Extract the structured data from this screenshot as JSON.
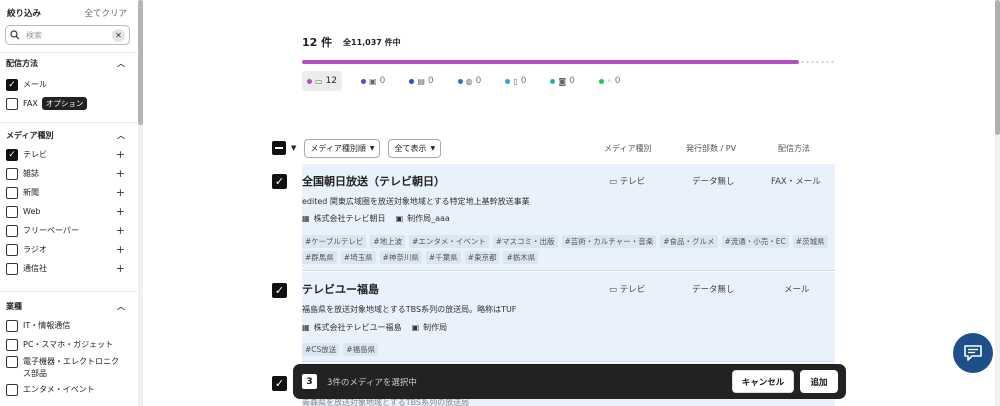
{
  "sidebar": {
    "title": "絞り込み",
    "clear_all": "全てクリア",
    "search_placeholder": "検索",
    "sections": [
      {
        "title": "配信方法",
        "options": [
          {
            "label": "メール",
            "checked": true
          },
          {
            "label": "FAX",
            "checked": false,
            "badge": "オプション"
          }
        ]
      },
      {
        "title": "メディア種別",
        "options": [
          {
            "label": "テレビ",
            "checked": true
          },
          {
            "label": "雑誌",
            "checked": false
          },
          {
            "label": "新聞",
            "checked": false
          },
          {
            "label": "Web",
            "checked": false
          },
          {
            "label": "フリーペーパー",
            "checked": false
          },
          {
            "label": "ラジオ",
            "checked": false
          },
          {
            "label": "通信社",
            "checked": false
          }
        ]
      },
      {
        "title": "業種",
        "options": [
          {
            "label": "IT・情報通信",
            "checked": false
          },
          {
            "label": "PC・スマホ・ガジェット",
            "checked": false
          },
          {
            "label": "電子機器・エレクトロニクス部品",
            "checked": false
          },
          {
            "label": "エンタメ・イベント",
            "checked": false
          }
        ]
      }
    ]
  },
  "results": {
    "count": "12 件",
    "total": "全11,037 件中",
    "progress_ratio": 0.93,
    "media_types": [
      {
        "icon": "tv-icon",
        "glyph": "▭",
        "count": "12",
        "color": "#b14fc5",
        "selected": true
      },
      {
        "icon": "magazine-icon",
        "glyph": "▣",
        "count": "0",
        "color": "#6a3fc9",
        "selected": false
      },
      {
        "icon": "newspaper-icon",
        "glyph": "▤",
        "count": "0",
        "color": "#1f4fd1",
        "selected": false
      },
      {
        "icon": "web-icon",
        "glyph": "◍",
        "count": "0",
        "color": "#2b6fe0",
        "selected": false
      },
      {
        "icon": "freepaper-icon",
        "glyph": "▯",
        "count": "0",
        "color": "#2aa0e6",
        "selected": false
      },
      {
        "icon": "radio-icon",
        "glyph": "◙",
        "count": "0",
        "color": "#1fb5a3",
        "selected": false
      },
      {
        "icon": "news-agency-icon",
        "glyph": "◦",
        "count": "0",
        "color": "#22c35a",
        "selected": false
      }
    ]
  },
  "toolbar": {
    "sort_label": "メディア種別順",
    "display_label": "全て表示",
    "col_media": "メディア種別",
    "col_dept": "発行部数 / PV",
    "col_delivery": "配信方法"
  },
  "rows": [
    {
      "name": "全国朝日放送（テレビ朝日）",
      "media": "テレビ",
      "dept": "データ無し",
      "delivery": "FAX・メール",
      "desc": "edited 関東広域圏を放送対象地域とする特定地上基幹放送事業",
      "company": "株式会社テレビ朝日",
      "division": "制作局_aaa",
      "tags": [
        "#ケーブルテレビ",
        "#地上波",
        "#エンタメ・イベント",
        "#マスコミ・出版",
        "#芸術・カルチャー・音楽",
        "#食品・グルメ",
        "#流通・小売・EC",
        "#茨城県",
        "#群馬県",
        "#埼玉県",
        "#神奈川県",
        "#千葉県",
        "#東京都",
        "#栃木県"
      ]
    },
    {
      "name": "テレビユー福島",
      "media": "テレビ",
      "dept": "データ無し",
      "delivery": "メール",
      "desc": "福島県を放送対象地域とするTBS系列の放送局。略称はTUF",
      "company": "株式会社テレビユー福島",
      "division": "制作局",
      "tags": [
        "#CS放送",
        "#福島県"
      ]
    },
    {
      "desc": "青森県を放送対象地域とするTBS系列の放送局"
    }
  ],
  "selection_bar": {
    "count": "3",
    "label": "3件のメディアを選択中",
    "cancel": "キャンセル",
    "add": "追加"
  }
}
